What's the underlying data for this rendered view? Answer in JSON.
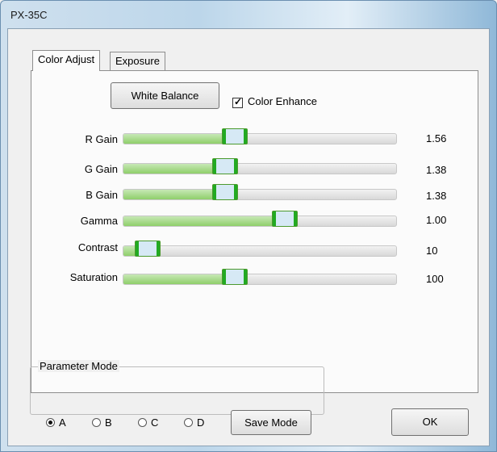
{
  "window": {
    "title": "PX-35C"
  },
  "tabs": [
    {
      "label": "Color Adjust",
      "active": true
    },
    {
      "label": "Exposure",
      "active": false
    }
  ],
  "color_adjust": {
    "white_balance_label": "White Balance",
    "color_enhance_label": "Color Enhance",
    "color_enhance_checked": true,
    "sliders": [
      {
        "label": "R Gain",
        "value": "1.56",
        "position": 0.4
      },
      {
        "label": "G Gain",
        "value": "1.38",
        "position": 0.36
      },
      {
        "label": "B Gain",
        "value": "1.38",
        "position": 0.36
      },
      {
        "label": "Gamma",
        "value": "1.00",
        "position": 0.6
      },
      {
        "label": "Contrast",
        "value": "10",
        "position": 0.05
      },
      {
        "label": "Saturation",
        "value": "100",
        "position": 0.4
      }
    ]
  },
  "parameter_mode": {
    "title": "Parameter Mode",
    "options": [
      "A",
      "B",
      "C",
      "D"
    ],
    "selected": "A",
    "save_label": "Save Mode"
  },
  "ok_label": "OK",
  "colors": {
    "slider_fill": "#8fcf6a",
    "thumb_edge": "#22aa22",
    "thumb_center": "#d6e9f5"
  }
}
